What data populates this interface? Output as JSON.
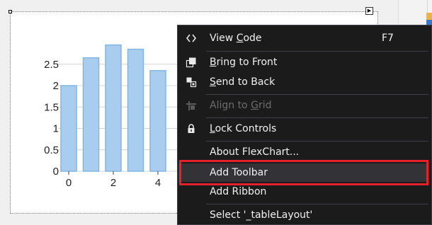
{
  "chart_data": {
    "type": "bar",
    "x": [
      0,
      1,
      2,
      3,
      4
    ],
    "values": [
      2.0,
      2.65,
      2.95,
      2.85,
      2.35
    ],
    "ylim": [
      0,
      3.2
    ],
    "y_ticks": [
      "0",
      "0.5",
      "1",
      "1.5",
      "2",
      "2.5"
    ],
    "x_ticks": [
      "0",
      "2",
      "4"
    ],
    "title": "",
    "xlabel": "",
    "ylabel": "",
    "grid": true,
    "bar_color": "#a9cdee",
    "bar_edge_color": "#84b5e0"
  },
  "context_menu": {
    "items": [
      {
        "key": "view_code",
        "pre": "View ",
        "ul": "C",
        "post": "ode",
        "shortcut": "F7",
        "icon": "code-icon",
        "disabled": false
      },
      {
        "key": "bring_front",
        "pre": "",
        "ul": "B",
        "post": "ring to Front",
        "shortcut": "",
        "icon": "bring-to-front-icon",
        "disabled": false
      },
      {
        "key": "send_back",
        "pre": "",
        "ul": "S",
        "post": "end to Back",
        "shortcut": "",
        "icon": "send-to-back-icon",
        "disabled": false
      },
      {
        "key": "align_grid",
        "pre": "Align to ",
        "ul": "G",
        "post": "rid",
        "shortcut": "",
        "icon": "align-to-grid-icon",
        "disabled": true
      },
      {
        "key": "lock_controls",
        "pre": "",
        "ul": "L",
        "post": "ock Controls",
        "shortcut": "",
        "icon": "lock-icon",
        "disabled": false
      },
      {
        "key": "about",
        "pre": "About FlexChart...",
        "ul": "",
        "post": "",
        "shortcut": "",
        "icon": "",
        "disabled": false
      },
      {
        "key": "add_toolbar",
        "pre": "Add Toolbar",
        "ul": "",
        "post": "",
        "shortcut": "",
        "icon": "",
        "disabled": false
      },
      {
        "key": "add_ribbon",
        "pre": "Add Ribbon",
        "ul": "",
        "post": "",
        "shortcut": "",
        "icon": "",
        "disabled": false
      },
      {
        "key": "select_table",
        "pre": "Select '_tableLayout'",
        "ul": "",
        "post": "",
        "shortcut": "",
        "icon": "",
        "disabled": false
      }
    ],
    "highlighted": "add_toolbar",
    "highlight_color": "#e3222b",
    "background_color": "#1b1b1c"
  }
}
